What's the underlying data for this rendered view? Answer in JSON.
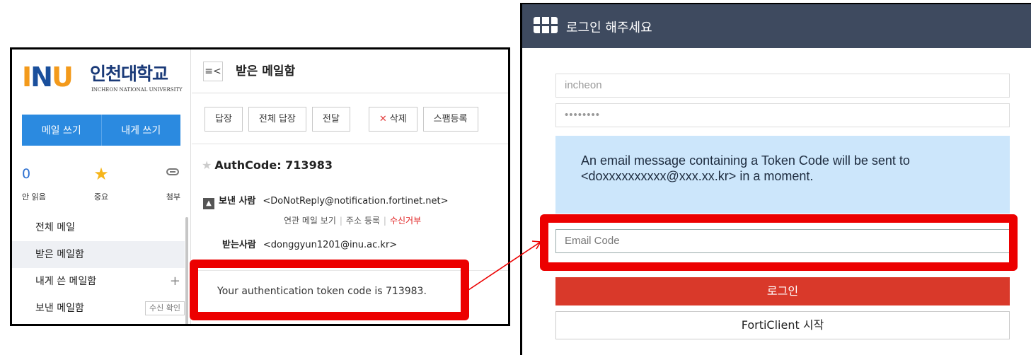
{
  "mail": {
    "logo": {
      "mark": "INU",
      "name": "인천대학교",
      "subtitle": "INCHEON NATIONAL UNIVERSITY"
    },
    "compose_label": "메일 쓰기",
    "self_compose_label": "내게 쓰기",
    "stats": [
      {
        "value": "0",
        "label": "안 읽음",
        "icon": "unread-count"
      },
      {
        "value": "★",
        "label": "중요",
        "icon": "star-icon"
      },
      {
        "value": "⊂⊃",
        "label": "첨부",
        "icon": "paperclip-icon"
      }
    ],
    "folders": [
      {
        "label": "전체 메일"
      },
      {
        "label": "받은 메일함",
        "selected": true
      },
      {
        "label": "내게 쓴 메일함",
        "action": "+"
      },
      {
        "label": "보낸 메일함",
        "badge": "수신 확인"
      }
    ],
    "menu_toggle": "≡<",
    "folder_title": "받은 메일함",
    "toolbar": {
      "reply": "답장",
      "reply_all": "전체 답장",
      "forward": "전달",
      "delete": "삭제",
      "spam": "스팸등록"
    },
    "subject": "AuthCode: 713983",
    "sender_label": "보낸 사람",
    "sender": "<DoNotReply@notification.fortinet.net>",
    "sender_links": {
      "related": "연관 메일 보기",
      "add_address": "주소 등록",
      "block": "수신거부"
    },
    "recipient_label": "받는사람",
    "recipient": "<donggyun1201@inu.ac.kr>",
    "body": "Your authentication token code is 713983."
  },
  "login": {
    "title": "로그인 해주세요",
    "username": "incheon",
    "password_mask": "••••••••",
    "info_message": "An email message containing a Token Code will be sent to <doxxxxxxxxxx@xxx.xx.kr> in a moment.",
    "code_placeholder": "Email Code",
    "login_button": "로그인",
    "forticlient_button": "FortiClient 시작"
  },
  "colors": {
    "highlight": "#ec0000",
    "login_header": "#3e4a5f",
    "login_button": "#d9392a",
    "info_box": "#cce6fb",
    "compose_button": "#2b8ae0"
  }
}
